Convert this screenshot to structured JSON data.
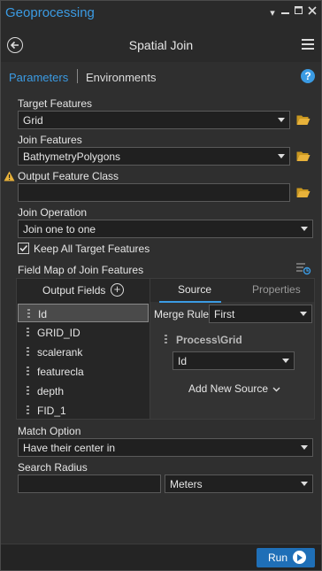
{
  "window": {
    "title": "Geoprocessing"
  },
  "tool": {
    "title": "Spatial Join"
  },
  "tabs": {
    "parameters": "Parameters",
    "environments": "Environments"
  },
  "params": {
    "target_label": "Target Features",
    "target_value": "Grid",
    "join_label": "Join Features",
    "join_value": "BathymetryPolygons",
    "output_label": "Output Feature Class",
    "output_value": "",
    "operation_label": "Join Operation",
    "operation_value": "Join one to one",
    "keep_all_label": "Keep All Target Features",
    "keep_all_checked": true,
    "fieldmap_label": "Field Map of Join Features",
    "match_label": "Match Option",
    "match_value": "Have their center in",
    "radius_label": "Search Radius",
    "radius_value": "",
    "radius_unit": "Meters"
  },
  "fieldmap": {
    "output_fields_label": "Output Fields",
    "fields": [
      "Id",
      "GRID_ID",
      "scalerank",
      "featurecla",
      "depth",
      "FID_1"
    ],
    "selected_field": "Id",
    "tab_source": "Source",
    "tab_properties": "Properties",
    "merge_rule_label": "Merge Rule",
    "merge_rule_value": "First",
    "source_header": "Process\\Grid",
    "source_field": "Id",
    "add_new_source": "Add New Source"
  },
  "footer": {
    "run_label": "Run"
  },
  "colors": {
    "accent": "#3b9be3",
    "warning": "#e8b23a",
    "folder": "#e8b23a",
    "run": "#1f6fb7"
  }
}
